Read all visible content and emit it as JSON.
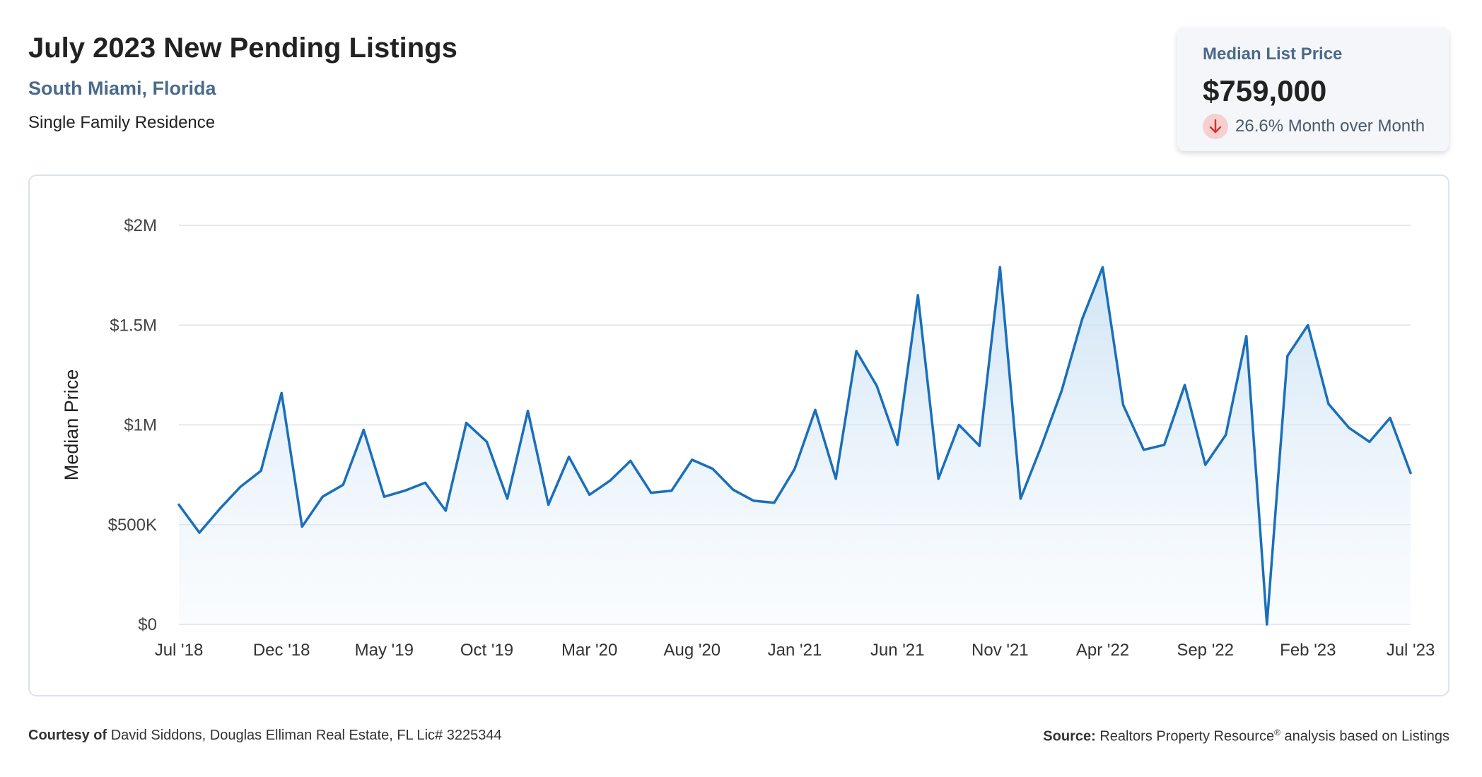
{
  "header": {
    "title": "July 2023 New Pending Listings",
    "location": "South Miami, Florida",
    "property_type": "Single Family Residence"
  },
  "stat_card": {
    "label": "Median List Price",
    "value": "$759,000",
    "change": "26.6% Month over Month",
    "direction": "down",
    "icon": "arrow-down-icon",
    "icon_color": "#d0342c"
  },
  "footer": {
    "courtesy_label": "Courtesy of",
    "courtesy_text": "David Siddons, Douglas Elliman Real Estate, FL Lic# 3225344",
    "source_label": "Source:",
    "source_text": "Realtors Property Resource",
    "source_mark": "®",
    "source_suffix": "analysis based on Listings"
  },
  "colors": {
    "line": "#1a6fba",
    "fill_top": "#c9e0f3",
    "grid": "#dde2e8",
    "axis_text": "#444444"
  },
  "chart_data": {
    "type": "area",
    "title": "",
    "xlabel": "",
    "ylabel": "Median Price",
    "ylim": [
      0,
      2000000
    ],
    "yticks": [
      0,
      500000,
      1000000,
      1500000,
      2000000
    ],
    "ytick_labels": [
      "$0",
      "$500K",
      "$1M",
      "$1.5M",
      "$2M"
    ],
    "xtick_labels": [
      "Jul '18",
      "Dec '18",
      "May '19",
      "Oct '19",
      "Mar '20",
      "Aug '20",
      "Jan '21",
      "Jun '21",
      "Nov '21",
      "Apr '22",
      "Sep '22",
      "Feb '23",
      "Jul '23"
    ],
    "xtick_step_months": 5,
    "grid": true,
    "legend": "none",
    "x": [
      "Jul '18",
      "Aug '18",
      "Sep '18",
      "Oct '18",
      "Nov '18",
      "Dec '18",
      "Jan '19",
      "Feb '19",
      "Mar '19",
      "Apr '19",
      "May '19",
      "Jun '19",
      "Jul '19",
      "Aug '19",
      "Sep '19",
      "Oct '19",
      "Nov '19",
      "Dec '19",
      "Jan '20",
      "Feb '20",
      "Mar '20",
      "Apr '20",
      "May '20",
      "Jun '20",
      "Jul '20",
      "Aug '20",
      "Sep '20",
      "Oct '20",
      "Nov '20",
      "Dec '20",
      "Jan '21",
      "Feb '21",
      "Mar '21",
      "Apr '21",
      "May '21",
      "Jun '21",
      "Jul '21",
      "Aug '21",
      "Sep '21",
      "Oct '21",
      "Nov '21",
      "Dec '21",
      "Jan '22",
      "Feb '22",
      "Mar '22",
      "Apr '22",
      "May '22",
      "Jun '22",
      "Jul '22",
      "Aug '22",
      "Sep '22",
      "Oct '22",
      "Nov '22",
      "Dec '22",
      "Jan '23",
      "Feb '23",
      "Mar '23",
      "Apr '23",
      "May '23",
      "Jun '23",
      "Jul '23"
    ],
    "values": [
      600000,
      460000,
      580000,
      690000,
      770000,
      1160000,
      490000,
      640000,
      700000,
      975000,
      640000,
      670000,
      710000,
      570000,
      1010000,
      915000,
      630000,
      1070000,
      600000,
      840000,
      650000,
      720000,
      820000,
      660000,
      670000,
      825000,
      780000,
      675000,
      620000,
      610000,
      780000,
      1075000,
      730000,
      1370000,
      1195000,
      900000,
      1650000,
      730000,
      1000000,
      895000,
      1790000,
      630000,
      890000,
      1170000,
      1530000,
      1790000,
      1100000,
      875000,
      900000,
      1200000,
      800000,
      950000,
      1445000,
      0,
      1345000,
      1500000,
      1105000,
      985000,
      915000,
      1035000,
      759000
    ]
  }
}
